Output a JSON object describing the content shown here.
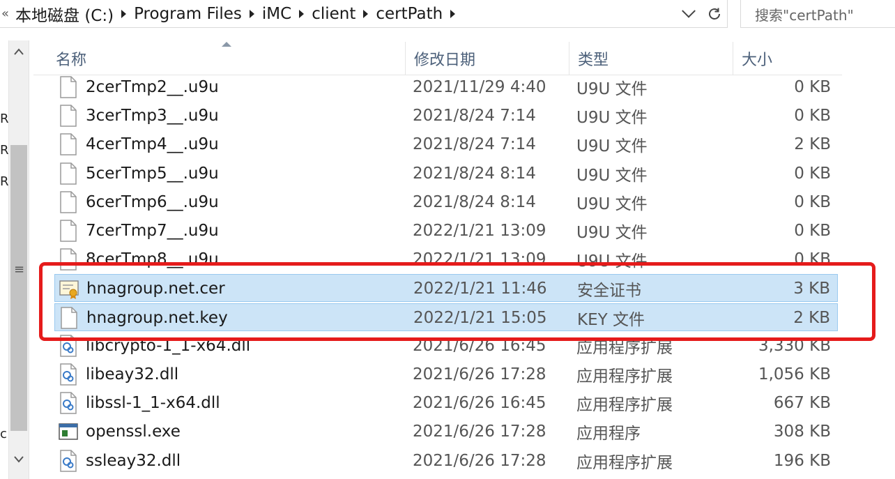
{
  "address": {
    "lead": "«",
    "crumbs": [
      "本地磁盘 (C:)",
      "Program Files",
      "iMC",
      "client",
      "certPath"
    ]
  },
  "search": {
    "placeholder": "搜索\"certPath\""
  },
  "columns": {
    "name": "名称",
    "date": "修改日期",
    "type": "类型",
    "size": "大小"
  },
  "left_edge_chars": [
    "R",
    "R",
    "R",
    "c"
  ],
  "files": [
    {
      "name": "2cerTmp2__.u9u",
      "date": "2021/11/29 4:40",
      "type": "U9U 文件",
      "size": "0 KB",
      "icon": "blank-file-icon",
      "selected": false
    },
    {
      "name": "3cerTmp3__.u9u",
      "date": "2021/8/24 7:14",
      "type": "U9U 文件",
      "size": "0 KB",
      "icon": "blank-file-icon",
      "selected": false
    },
    {
      "name": "4cerTmp4__.u9u",
      "date": "2021/8/24 7:14",
      "type": "U9U 文件",
      "size": "2 KB",
      "icon": "blank-file-icon",
      "selected": false
    },
    {
      "name": "5cerTmp5__.u9u",
      "date": "2021/8/24 8:14",
      "type": "U9U 文件",
      "size": "0 KB",
      "icon": "blank-file-icon",
      "selected": false
    },
    {
      "name": "6cerTmp6__.u9u",
      "date": "2021/8/24 8:14",
      "type": "U9U 文件",
      "size": "0 KB",
      "icon": "blank-file-icon",
      "selected": false
    },
    {
      "name": "7cerTmp7__.u9u",
      "date": "2022/1/21 13:09",
      "type": "U9U 文件",
      "size": "0 KB",
      "icon": "blank-file-icon",
      "selected": false
    },
    {
      "name": "8cerTmp8__.u9u",
      "date": "2022/1/21 13:09",
      "type": "U9U 文件",
      "size": "0 KB",
      "icon": "blank-file-icon",
      "selected": false
    },
    {
      "name": "hnagroup.net.cer",
      "date": "2022/1/21 11:46",
      "type": "安全证书",
      "size": "3 KB",
      "icon": "certificate-icon",
      "selected": true
    },
    {
      "name": "hnagroup.net.key",
      "date": "2022/1/21 15:05",
      "type": "KEY 文件",
      "size": "2 KB",
      "icon": "blank-file-icon",
      "selected": true
    },
    {
      "name": "libcrypto-1_1-x64.dll",
      "date": "2021/6/26 16:45",
      "type": "应用程序扩展",
      "size": "3,330 KB",
      "icon": "dll-icon",
      "selected": false
    },
    {
      "name": "libeay32.dll",
      "date": "2021/6/26 17:28",
      "type": "应用程序扩展",
      "size": "1,056 KB",
      "icon": "dll-icon",
      "selected": false
    },
    {
      "name": "libssl-1_1-x64.dll",
      "date": "2021/6/26 16:45",
      "type": "应用程序扩展",
      "size": "667 KB",
      "icon": "dll-icon",
      "selected": false
    },
    {
      "name": "openssl.exe",
      "date": "2021/6/26 17:28",
      "type": "应用程序",
      "size": "308 KB",
      "icon": "exe-icon",
      "selected": false
    },
    {
      "name": "ssleay32.dll",
      "date": "2021/6/26 17:28",
      "type": "应用程序扩展",
      "size": "196 KB",
      "icon": "dll-icon",
      "selected": false
    }
  ],
  "colors": {
    "selection_bg": "#cce4f7",
    "selection_border": "#99c9ef",
    "highlight_border": "#e51b1b",
    "header_text": "#4c607a"
  }
}
